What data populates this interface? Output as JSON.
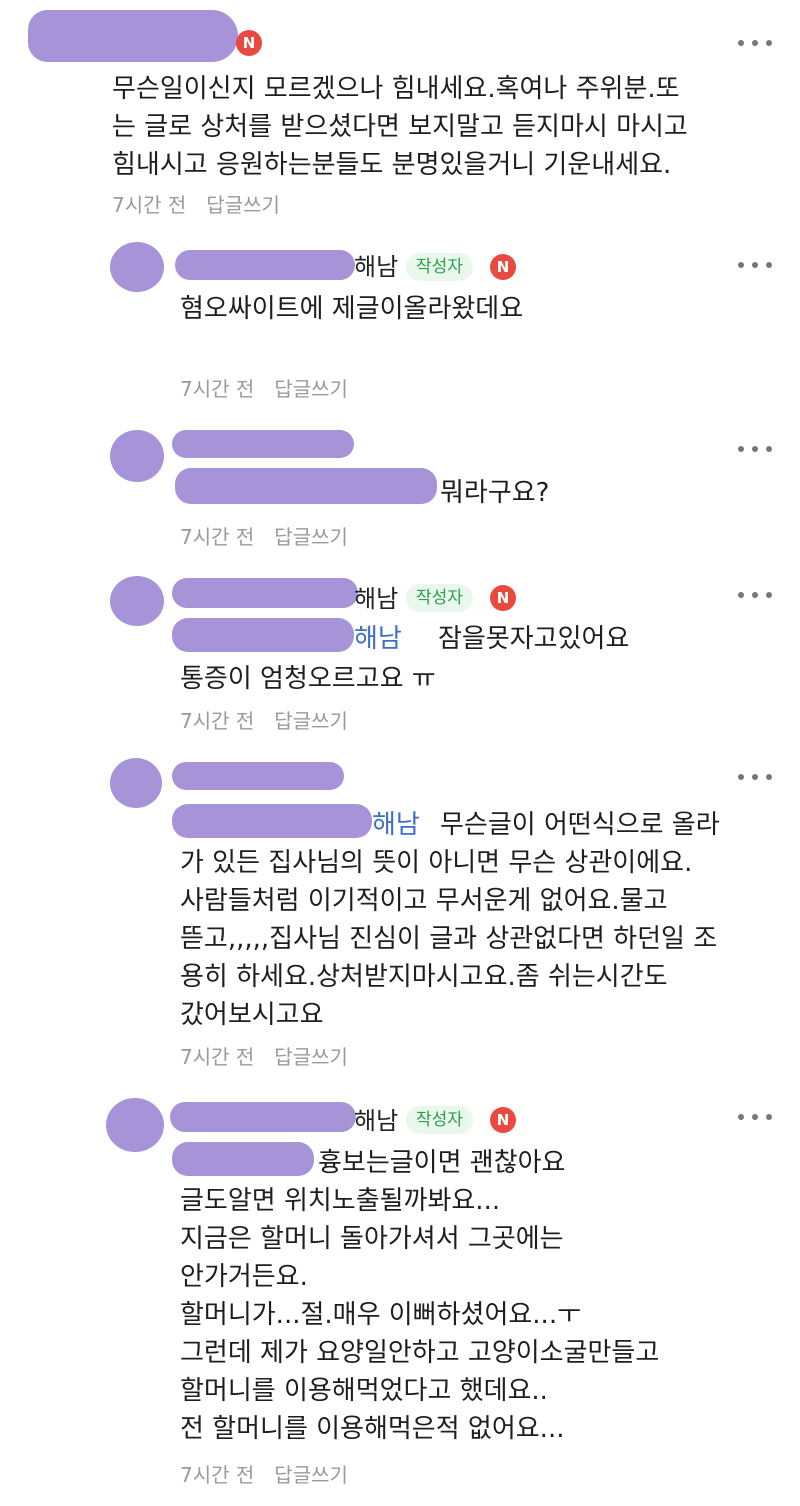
{
  "badges": {
    "author": "작성자",
    "new": "N"
  },
  "comments": [
    {
      "id": "c1",
      "body": "무슨일이신지 모르겠으나 힘내세요.혹여나 주위분.또\n는 글로 상처를 받으셨다면 보지말고 듣지마시 마시고\n힘내시고 응원하는분들도 분명있을거니 기운내세요.",
      "time": "7시간 전",
      "reply": "답글쓰기"
    },
    {
      "id": "c2",
      "name_tail": "해남",
      "body": "혐오싸이트에 제글이올라왔데요",
      "time": "7시간 전",
      "reply": "답글쓰기"
    },
    {
      "id": "c3",
      "body": "뭐라구요?",
      "time": "7시간 전",
      "reply": "답글쓰기"
    },
    {
      "id": "c4",
      "name_tail": "해남",
      "mention_tail": "해남",
      "body_first": "잠을못자고있어요",
      "body": "통증이 엄청오르고요 ㅠ",
      "time": "7시간 전",
      "reply": "답글쓰기"
    },
    {
      "id": "c5",
      "mention_tail": "해남",
      "body_first": "무슨글이 어떤식으로 올라",
      "body": "가 있든 집사님의 뜻이 아니면 무슨 상관이에요.\n사람들처럼 이기적이고 무서운게 없어요.물고\n뜯고,,,,,집사님 진심이 글과 상관없다면 하던일 조\n용히 하세요.상처받지마시고요.좀 쉬는시간도\n갔어보시고요",
      "time": "7시간 전",
      "reply": "답글쓰기"
    },
    {
      "id": "c6",
      "name_tail": "해남",
      "body_first": "흉보는글이면 괜찮아요",
      "body": "글도알면 위치노출될까봐요...\n지금은 할머니 돌아가셔서 그곳에는\n안가거든요.\n할머니가...절.매우 이뻐하셨어요...ㅜ\n그런데 제가 요양일안하고 고양이소굴만들고\n할머니를 이용해먹었다고 했데요..\n전 할머니를 이용해먹은적 없어요...",
      "time": "7시간 전",
      "reply": "답글쓰기"
    }
  ]
}
